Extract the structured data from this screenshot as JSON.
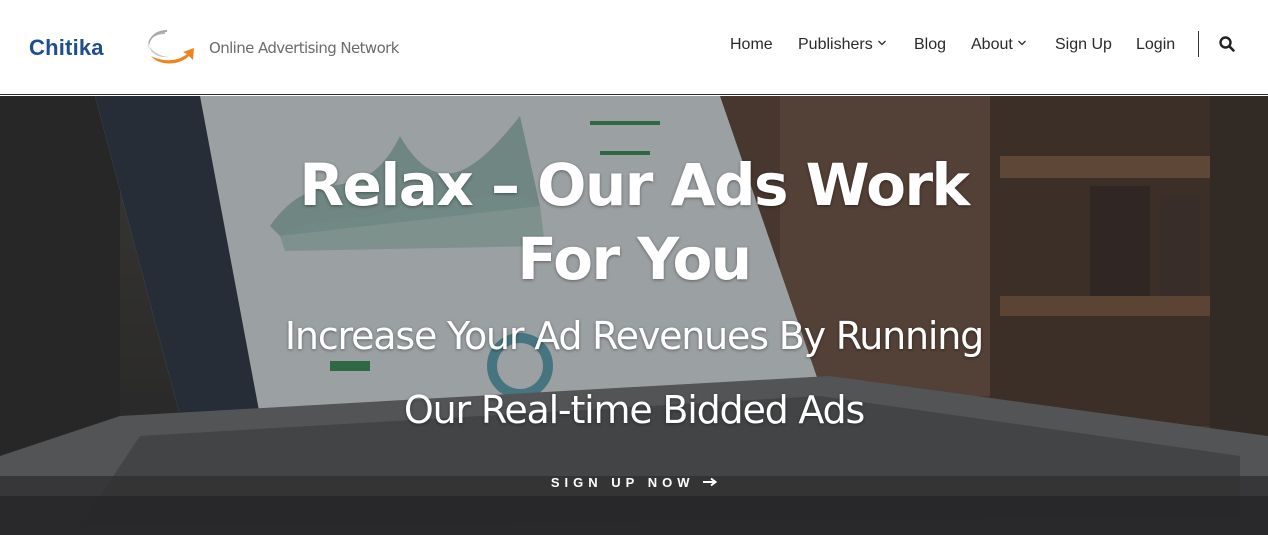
{
  "brand": {
    "name": "Chitika",
    "tagline": "Online Advertising Network",
    "colors": {
      "blue": "#1f4e8f",
      "orange": "#f0841c",
      "gray": "#9a9a9a"
    }
  },
  "nav": {
    "items": [
      {
        "label": "Home",
        "has_dropdown": false
      },
      {
        "label": "Publishers",
        "has_dropdown": true
      },
      {
        "label": "Blog",
        "has_dropdown": false
      },
      {
        "label": "About",
        "has_dropdown": true
      },
      {
        "label": "Sign Up",
        "has_dropdown": false
      },
      {
        "label": "Login",
        "has_dropdown": false
      }
    ],
    "search_icon": "search-icon",
    "dropdown_icon": "chevron-down-icon"
  },
  "hero": {
    "title_line1": "Relax – Our Ads Work",
    "title_line2": "For You",
    "subtitle_line1": "Increase Your Ad Revenues By Running",
    "subtitle_line2": "Our Real-time Bidded Ads",
    "cta_label": "SIGN UP NOW",
    "cta_icon": "arrow-right-icon"
  }
}
